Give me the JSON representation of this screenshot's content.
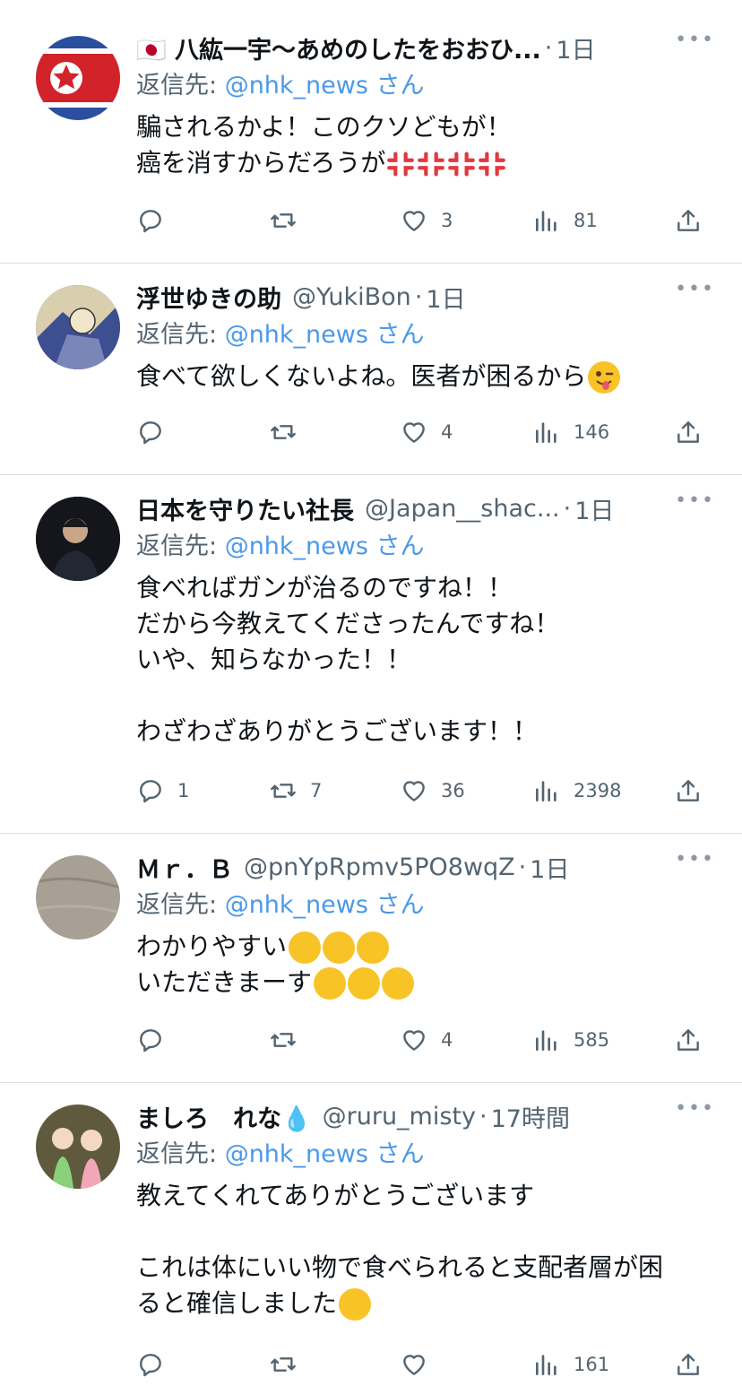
{
  "tweets": [
    {
      "name": "🇯🇵 八紘一宇〜あめのしたをおおひ...",
      "handle": "",
      "time": "1日",
      "reply_prefix": "返信先: ",
      "reply_mention": "@nhk_news",
      "reply_suffix": " さん",
      "text": "騙されるかよ！このクソどもが！\n癌を消すからだろうが",
      "emoji_tail": "anger x4",
      "counts": {
        "reply": "",
        "retweet": "",
        "like": "3",
        "views": "81"
      }
    },
    {
      "name": "浮世ゆきの助",
      "handle": "@YukiBon",
      "time": "1日",
      "reply_prefix": "返信先: ",
      "reply_mention": "@nhk_news",
      "reply_suffix": " さん",
      "text": "食べて欲しくないよね。医者が困るから",
      "emoji_tail": "winking-tongue-face",
      "counts": {
        "reply": "",
        "retweet": "",
        "like": "4",
        "views": "146"
      }
    },
    {
      "name": "日本を守りたい社長",
      "handle": "@Japan__shac...",
      "time": "1日",
      "reply_prefix": "返信先: ",
      "reply_mention": "@nhk_news",
      "reply_suffix": " さん",
      "text": "食べればガンが治るのですね！！\nだから今教えてくださったんですね！\nいや、知らなかった！！\n\nわざわざありがとうございます！！",
      "emoji_tail": "",
      "counts": {
        "reply": "1",
        "retweet": "7",
        "like": "36",
        "views": "2398"
      }
    },
    {
      "name": "Ｍｒ．Ｂ",
      "handle": "@pnYpRpmv5PO8wqZ",
      "time": "1日",
      "reply_prefix": "返信先: ",
      "reply_mention": "@nhk_news",
      "reply_suffix": " さん",
      "text_line1": "わかりやすい",
      "text_line2": "いただきまーす",
      "emoji_tail": "rolling-laughing x3",
      "counts": {
        "reply": "",
        "retweet": "",
        "like": "4",
        "views": "585"
      }
    },
    {
      "name": "ましろ　れな💧",
      "handle": "@ruru_misty",
      "time": "17時間",
      "reply_prefix": "返信先: ",
      "reply_mention": "@nhk_news",
      "reply_suffix": " さん",
      "text": "教えてくれてありがとうございます\n\nこれは体にいい物で食べられると支配者層が困\nると確信しました",
      "emoji_tail": "hugging-face",
      "counts": {
        "reply": "",
        "retweet": "",
        "like": "",
        "views": "161"
      }
    }
  ],
  "more_label": "•••",
  "icons": [
    "reply-icon",
    "retweet-icon",
    "like-icon",
    "views-icon",
    "share-icon",
    "more-icon"
  ],
  "colors": {
    "mention": "#4a99e9",
    "secondary": "#536471",
    "divider": "#d9dee2"
  }
}
